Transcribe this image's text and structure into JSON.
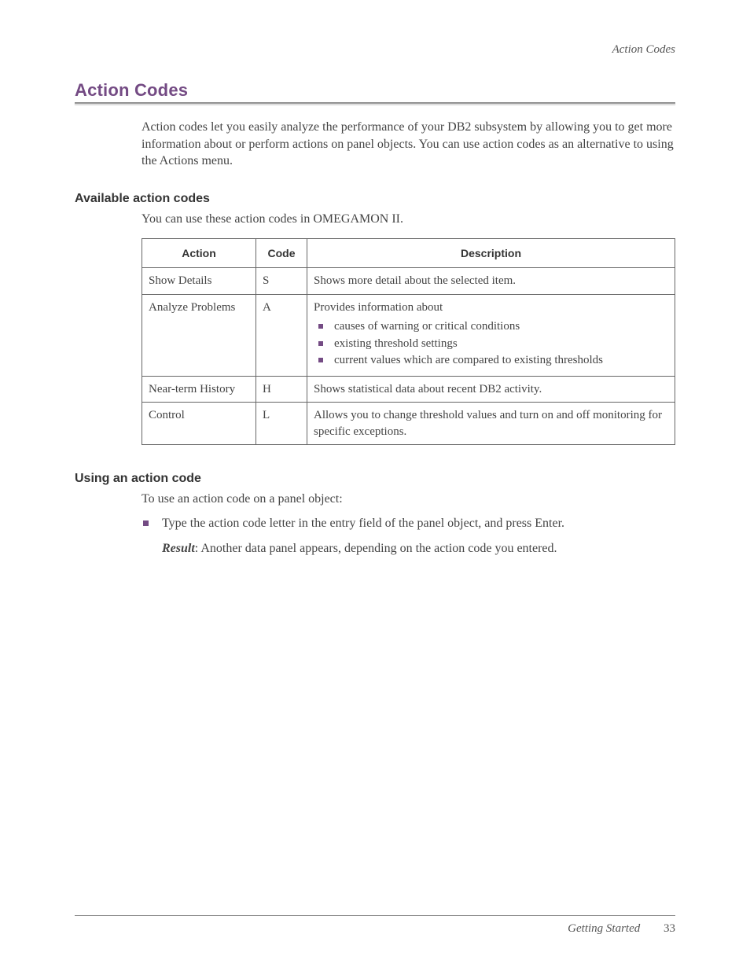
{
  "running_header": "Action Codes",
  "main_heading": "Action Codes",
  "intro_paragraph": "Action codes let you easily analyze the performance of your DB2 subsystem by allowing you to get more information about or perform actions on panel objects. You can use action codes as an alternative to using the Actions menu.",
  "section_available": {
    "heading": "Available action codes",
    "intro": "You can use these action codes in OMEGAMON II.",
    "table": {
      "headers": {
        "action": "Action",
        "code": "Code",
        "description": "Description"
      },
      "rows": [
        {
          "action": "Show Details",
          "code": "S",
          "description": "Shows more detail about the selected item."
        },
        {
          "action": "Analyze Problems",
          "code": "A",
          "description_lead": "Provides information about",
          "bullets": [
            "causes of warning or critical conditions",
            "existing threshold settings",
            "current values which are compared to existing thresholds"
          ]
        },
        {
          "action": "Near-term History",
          "code": "H",
          "description": "Shows statistical data about recent DB2 activity."
        },
        {
          "action": "Control",
          "code": "L",
          "description": "Allows you to change threshold values and turn on and off monitoring for specific exceptions."
        }
      ]
    }
  },
  "section_using": {
    "heading": "Using an action code",
    "intro": "To use an action code on a panel object:",
    "step_text": "Type the action code letter in the entry field of the panel object, and press Enter.",
    "result_label": "Result",
    "result_text": ": Another data panel appears, depending on the action code you entered."
  },
  "footer": {
    "doc_name": "Getting Started",
    "page_number": "33"
  }
}
